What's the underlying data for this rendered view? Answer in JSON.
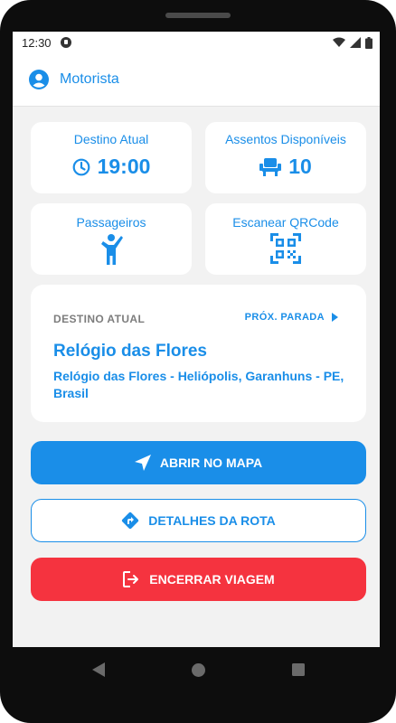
{
  "status": {
    "time": "12:30"
  },
  "header": {
    "title": "Motorista"
  },
  "cards": {
    "destination": {
      "label": "Destino Atual",
      "value": "19:00"
    },
    "seats": {
      "label": "Assentos Disponíveis",
      "value": "10"
    },
    "passengers": {
      "label": "Passageiros"
    },
    "qrcode": {
      "label": "Escanear QRCode"
    }
  },
  "current_destination": {
    "section_label": "DESTINO ATUAL",
    "next_stop_label": "PRÓX. PARADA",
    "name": "Relógio das Flores",
    "address": "Relógio das Flores - Heliópolis, Garanhuns - PE, Brasil"
  },
  "buttons": {
    "open_map": "ABRIR NO MAPA",
    "route_details": "DETALHES DA ROTA",
    "end_trip": "ENCERRAR VIAGEM"
  },
  "colors": {
    "accent": "#1a8ee8",
    "danger": "#f5333f",
    "background": "#f2f2f2"
  },
  "icons": [
    "user-circle-icon",
    "clock-icon",
    "seat-icon",
    "person-icon",
    "qr-code-icon",
    "triangle-right-icon",
    "navigation-arrow-icon",
    "directions-icon",
    "exit-icon"
  ]
}
